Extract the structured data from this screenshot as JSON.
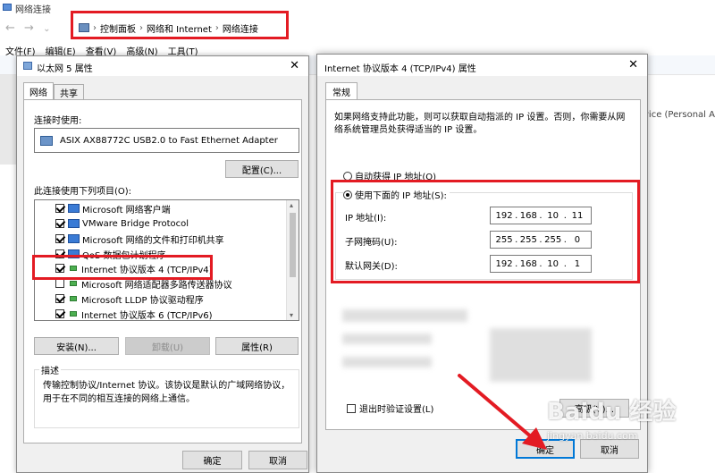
{
  "explorer": {
    "title": "网络连接",
    "breadcrumb": [
      "控制面板",
      "网络和 Internet",
      "网络连接"
    ],
    "menu": [
      "文件(F)",
      "编辑(E)",
      "查看(V)",
      "高级(N)",
      "工具(T)"
    ],
    "partial_right_text": "vice (Personal Ar"
  },
  "eth_props": {
    "title": "以太网 5 属性",
    "tabs": [
      "网络",
      "共享"
    ],
    "connect_using_label": "连接时使用:",
    "adapter": "ASIX AX88772C USB2.0 to Fast Ethernet Adapter",
    "configure_btn": "配置(C)...",
    "items_label": "此连接使用下列项目(O):",
    "items": [
      "Microsoft 网络客户端",
      "VMware Bridge Protocol",
      "Microsoft 网络的文件和打印机共享",
      "QoS 数据包计划程序",
      "Internet 协议版本 4 (TCP/IPv4)",
      "Microsoft 网络适配器多路传送器协议",
      "Microsoft LLDP 协议驱动程序",
      "Internet 协议版本 6 (TCP/IPv6)"
    ],
    "install_btn": "安装(N)...",
    "uninstall_btn": "卸载(U)",
    "properties_btn": "属性(R)",
    "desc_label": "描述",
    "desc_text": "传输控制协议/Internet 协议。该协议是默认的广域网络协议，用于在不同的相互连接的网络上通信。",
    "ok_btn": "确定",
    "cancel_btn": "取消"
  },
  "ipv4": {
    "title": "Internet 协议版本 4 (TCP/IPv4) 属性",
    "tab": "常规",
    "intro": "如果网络支持此功能，则可以获取自动指派的 IP 设置。否则，你需要从网络系统管理员处获得适当的 IP 设置。",
    "auto_ip": "自动获得 IP 地址(O)",
    "manual_ip": "使用下面的 IP 地址(S):",
    "ip_label": "IP 地址(I):",
    "mask_label": "子网掩码(U):",
    "gateway_label": "默认网关(D):",
    "ip": [
      "192",
      "168",
      "10",
      "11"
    ],
    "mask": [
      "255",
      "255",
      "255",
      "0"
    ],
    "gateway": [
      "192",
      "168",
      "10",
      "1"
    ],
    "validate_label": "退出时验证设置(L)",
    "advanced_btn": "高级(V)...",
    "ok_btn": "确定",
    "cancel_btn": "取消"
  },
  "watermark": "Baidu 经验",
  "watermark_sub": "jingyan.baidu.com",
  "colors": {
    "highlight": "#e31b23",
    "accent": "#0078d7"
  }
}
